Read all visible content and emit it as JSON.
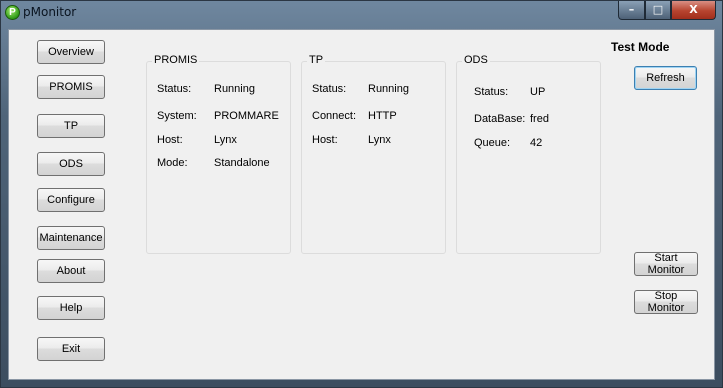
{
  "window": {
    "title": "pMonitor",
    "icon_letter": "P"
  },
  "caption_buttons": {
    "minimize": "–",
    "maximize": "□",
    "close": "X"
  },
  "nav": {
    "overview": "Overview",
    "promis": "PROMIS",
    "tp": "TP",
    "ods": "ODS",
    "configure": "Configure",
    "maintenance": "Maintenance",
    "about": "About",
    "help": "Help",
    "exit": "Exit"
  },
  "promis": {
    "title": "PROMIS",
    "status_label": "Status:",
    "status_value": "Running",
    "system_label": "System:",
    "system_value": "PROMMARE",
    "host_label": "Host:",
    "host_value": "Lynx",
    "mode_label": "Mode:",
    "mode_value": "Standalone"
  },
  "tp": {
    "title": "TP",
    "status_label": "Status:",
    "status_value": "Running",
    "connect_label": "Connect:",
    "connect_value": "HTTP",
    "host_label": "Host:",
    "host_value": "Lynx"
  },
  "ods": {
    "title": "ODS",
    "status_label": "Status:",
    "status_value": "UP",
    "database_label": "DataBase:",
    "database_value": "fred",
    "queue_label": "Queue:",
    "queue_value": "42"
  },
  "right_panel": {
    "mode": "Test Mode",
    "refresh": "Refresh",
    "start_monitor": "Start Monitor",
    "stop_monitor": "Stop Monitor"
  }
}
